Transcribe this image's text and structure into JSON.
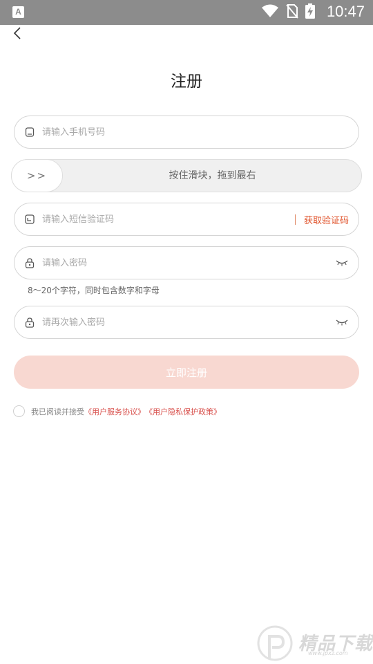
{
  "status_bar": {
    "app_badge": "A",
    "time": "10:47",
    "icons": [
      "wifi-icon",
      "no-sim-icon",
      "battery-charging-icon"
    ]
  },
  "header": {
    "back_icon": "chevron-left-icon",
    "title": "注册"
  },
  "form": {
    "phone": {
      "placeholder": "请输入手机号码",
      "icon": "phone-icon"
    },
    "slider": {
      "handle_label": ">>",
      "hint": "按住滑块，拖到最右"
    },
    "sms": {
      "placeholder": "请输入短信验证码",
      "icon": "message-icon",
      "button_label": "获取验证码"
    },
    "password": {
      "placeholder": "请输入密码",
      "icon": "lock-icon",
      "toggle_icon": "eye-closed-icon"
    },
    "password_hint": "8～20个字符，同时包含数字和字母",
    "confirm_password": {
      "placeholder": "请再次输入密码",
      "icon": "lock-icon",
      "toggle_icon": "eye-closed-icon"
    },
    "submit_label": "立即注册"
  },
  "agreement": {
    "prefix": "我已阅读并接受",
    "terms_link": "《用户服务协议》",
    "privacy_link": "《用户隐私保护政策》"
  },
  "watermark": {
    "text": "精品下载",
    "url": "www.jpxz.com"
  },
  "colors": {
    "accent": "#e0522a",
    "submit_disabled": "#f8d8d1",
    "status_bar": "#8c8c8c"
  }
}
